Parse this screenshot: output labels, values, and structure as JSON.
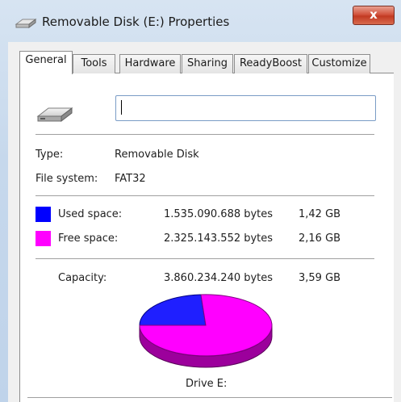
{
  "window": {
    "title": "Removable Disk (E:) Properties",
    "close_label": "x"
  },
  "tabs": [
    {
      "label": "General",
      "active": true
    },
    {
      "label": "Tools",
      "active": false
    },
    {
      "label": "Hardware",
      "active": false
    },
    {
      "label": "Sharing",
      "active": false
    },
    {
      "label": "ReadyBoost",
      "active": false
    },
    {
      "label": "Customize",
      "active": false
    }
  ],
  "general": {
    "name_value": "",
    "type_label": "Type:",
    "type_value": "Removable Disk",
    "fs_label": "File system:",
    "fs_value": "FAT32",
    "used": {
      "label": "Used space:",
      "bytes": "1.535.090.688 bytes",
      "size": "1,42 GB",
      "color": "#0000ff"
    },
    "free": {
      "label": "Free space:",
      "bytes": "2.325.143.552 bytes",
      "size": "2,16 GB",
      "color": "#ff00ff"
    },
    "capacity": {
      "label": "Capacity:",
      "bytes": "3.860.234.240 bytes",
      "size": "3,59 GB"
    },
    "drive_label": "Drive E:"
  },
  "icons": {
    "title": "drive-icon",
    "drive": "removable-drive-icon",
    "close": "close-icon"
  }
}
